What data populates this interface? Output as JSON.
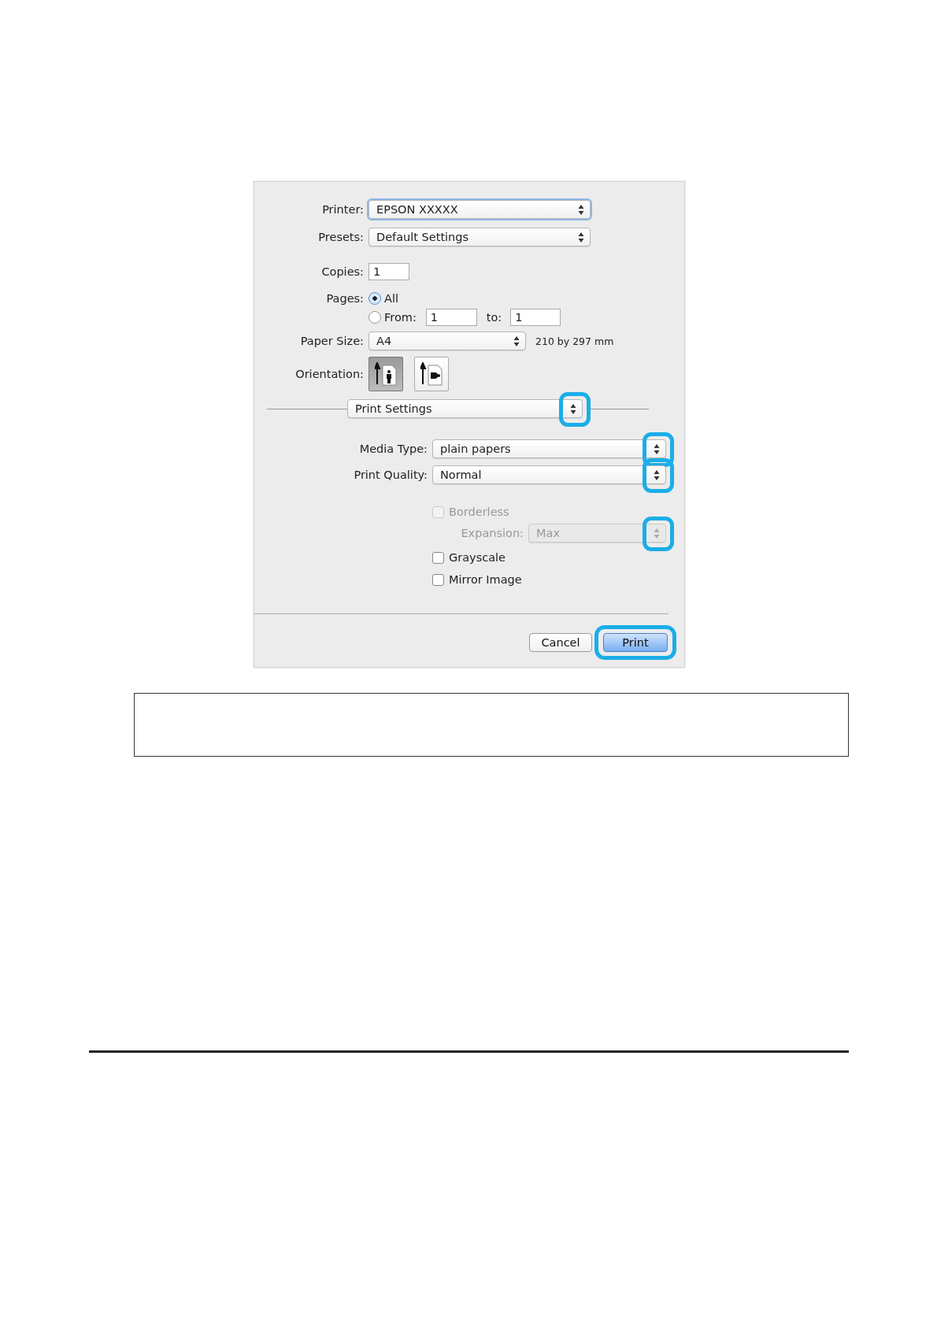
{
  "dialog": {
    "printer": {
      "label": "Printer:",
      "value": "EPSON XXXXX",
      "focused": true
    },
    "presets": {
      "label": "Presets:",
      "value": "Default Settings"
    },
    "copies": {
      "label": "Copies:",
      "value": "1"
    },
    "pages": {
      "label": "Pages:",
      "options": [
        {
          "label": "All",
          "selected": true
        },
        {
          "label": "From:",
          "selected": false
        }
      ],
      "from": "1",
      "to_label": "to:",
      "to": "1"
    },
    "paper_size": {
      "label": "Paper Size:",
      "value": "A4",
      "dimensions": "210 by 297 mm"
    },
    "orientation": {
      "label": "Orientation:",
      "options": [
        {
          "kind": "portrait",
          "selected": true
        },
        {
          "kind": "landscape",
          "selected": false
        }
      ]
    },
    "panel": {
      "value": "Print Settings",
      "highlighted": true
    },
    "settings": [
      {
        "kind": "popup",
        "label": "Media Type:",
        "value": "plain papers",
        "indented": false,
        "disabled": false,
        "highlighted": true
      },
      {
        "kind": "popup",
        "label": "Print Quality:",
        "value": "Normal",
        "indented": false,
        "disabled": false,
        "highlighted": true
      },
      {
        "kind": "checkbox",
        "label": "Borderless",
        "checked": false,
        "disabled": true
      },
      {
        "kind": "popup",
        "label": "Expansion:",
        "value": "Max",
        "indented": true,
        "disabled": true,
        "highlighted": true
      },
      {
        "kind": "checkbox",
        "label": "Grayscale",
        "checked": false,
        "disabled": false
      },
      {
        "kind": "checkbox",
        "label": "Mirror Image",
        "checked": false,
        "disabled": false
      }
    ],
    "buttons": [
      {
        "label": "Cancel",
        "default": false,
        "highlighted": false
      },
      {
        "label": "Print",
        "default": true,
        "highlighted": true
      }
    ]
  }
}
